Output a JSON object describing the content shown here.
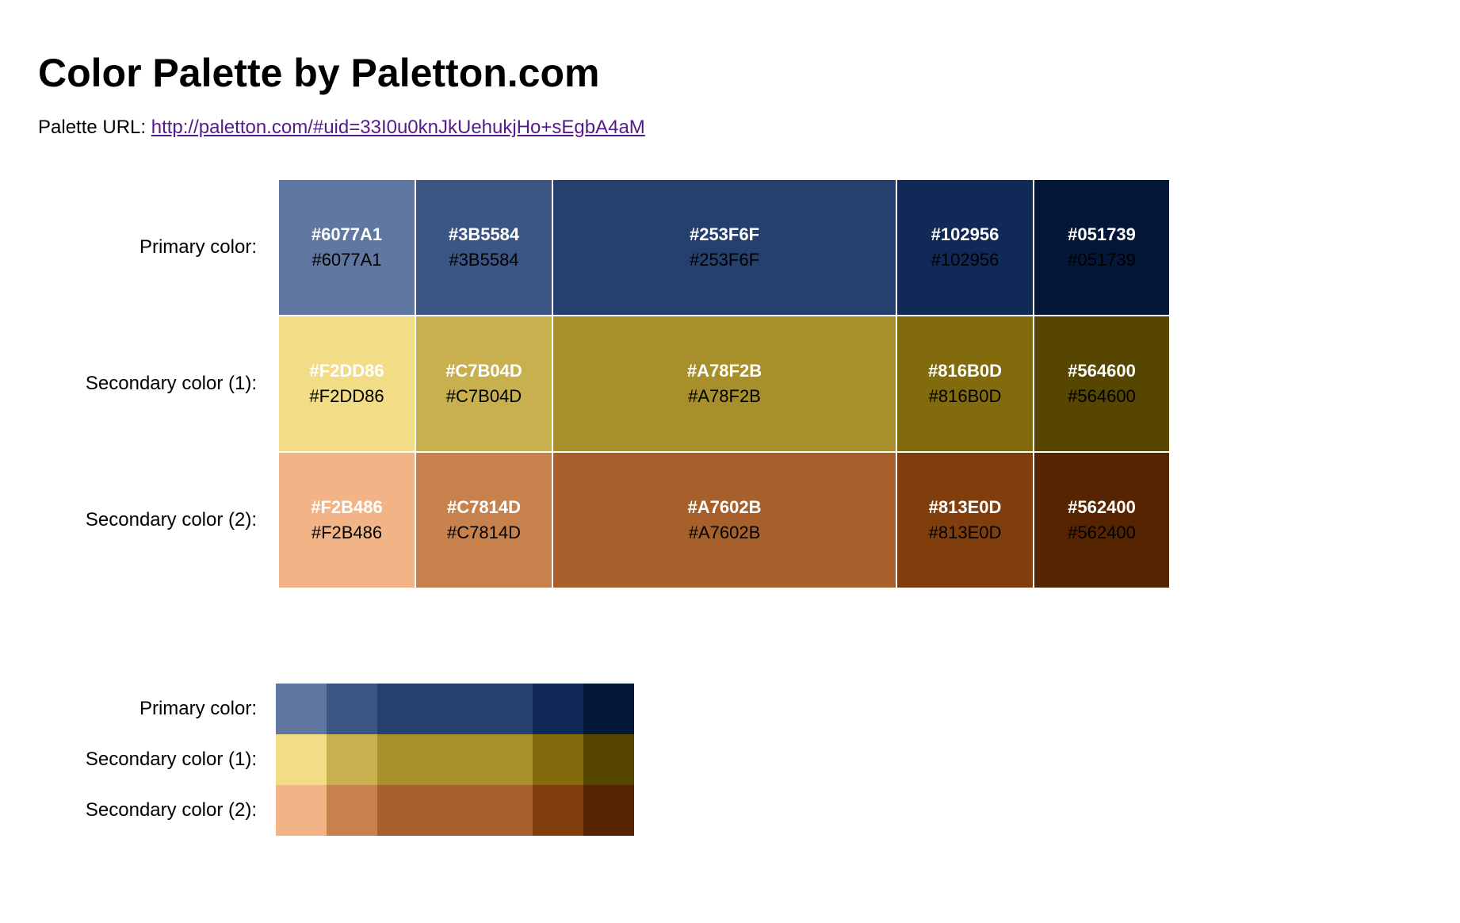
{
  "header": {
    "title": "Color Palette by Paletton.com",
    "url_label": "Palette URL: ",
    "url": "http://paletton.com/#uid=33I0u0knJkUehukjHo+sEgbA4aM"
  },
  "palette": {
    "rows": [
      {
        "label": "Primary color:",
        "swatches": [
          {
            "hex": "#6077A1",
            "color": "#6077A1"
          },
          {
            "hex": "#3B5584",
            "color": "#3B5584"
          },
          {
            "hex": "#253F6F",
            "color": "#253F6F"
          },
          {
            "hex": "#102956",
            "color": "#102956"
          },
          {
            "hex": "#051739",
            "color": "#051739"
          }
        ]
      },
      {
        "label": "Secondary color (1):",
        "swatches": [
          {
            "hex": "#F2DD86",
            "color": "#F2DD86"
          },
          {
            "hex": "#C7B04D",
            "color": "#C7B04D"
          },
          {
            "hex": "#A78F2B",
            "color": "#A78F2B"
          },
          {
            "hex": "#816B0D",
            "color": "#816B0D"
          },
          {
            "hex": "#564600",
            "color": "#564600"
          }
        ]
      },
      {
        "label": "Secondary color (2):",
        "swatches": [
          {
            "hex": "#F2B486",
            "color": "#F2B486"
          },
          {
            "hex": "#C7814D",
            "color": "#C7814D"
          },
          {
            "hex": "#A7602B",
            "color": "#A7602B"
          },
          {
            "hex": "#813E0D",
            "color": "#813E0D"
          },
          {
            "hex": "#562400",
            "color": "#562400"
          }
        ]
      }
    ]
  },
  "mini_palette": {
    "rows": [
      {
        "label": "Primary color:",
        "colors": [
          "#6077A1",
          "#3B5584",
          "#253F6F",
          "#102956",
          "#051739"
        ]
      },
      {
        "label": "Secondary color (1):",
        "colors": [
          "#F2DD86",
          "#C7B04D",
          "#A78F2B",
          "#816B0D",
          "#564600"
        ]
      },
      {
        "label": "Secondary color (2):",
        "colors": [
          "#F2B486",
          "#C7814D",
          "#A7602B",
          "#813E0D",
          "#562400"
        ]
      }
    ]
  }
}
